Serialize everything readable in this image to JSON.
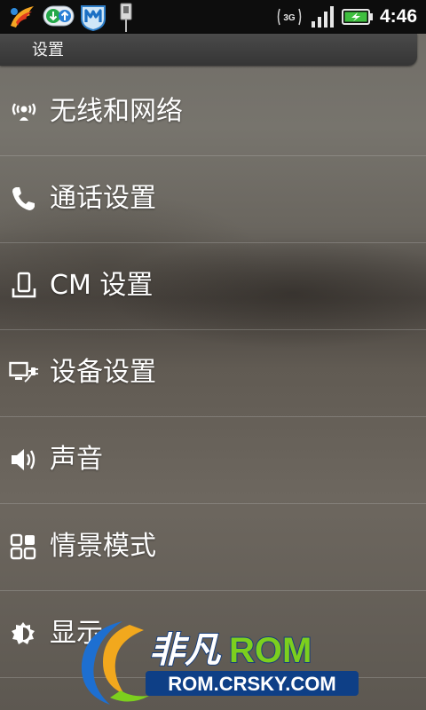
{
  "status_bar": {
    "network": "3G",
    "time": "4:46",
    "icons": [
      "app-launcher-icon",
      "download-manager-icon",
      "security-app-icon",
      "usb-debug-icon",
      "3g-icon",
      "signal-bars-icon",
      "battery-charging-icon"
    ]
  },
  "header": {
    "title": "设置"
  },
  "settings": {
    "items": [
      {
        "label": "无线和网络",
        "icon": "wireless-icon"
      },
      {
        "label": "通话设置",
        "icon": "phone-icon"
      },
      {
        "label": "CM 设置",
        "icon": "device-dock-icon"
      },
      {
        "label": "设备设置",
        "icon": "monitor-plug-icon"
      },
      {
        "label": "声音",
        "icon": "speaker-icon"
      },
      {
        "label": "情景模式",
        "icon": "grid-profile-icon"
      },
      {
        "label": "显示",
        "icon": "brightness-icon"
      }
    ]
  },
  "watermark": {
    "brand": "非凡",
    "brand_suffix": "ROM",
    "url": "ROM.CRSKY.COM"
  },
  "colors": {
    "status_bar_bg": "#0d0d0d",
    "title_bar_bg": "#404040",
    "text": "#ffffff",
    "watermark_green": "#7ccf1e",
    "watermark_blue": "#1d6fd1",
    "battery_green": "#3fbf3f"
  }
}
